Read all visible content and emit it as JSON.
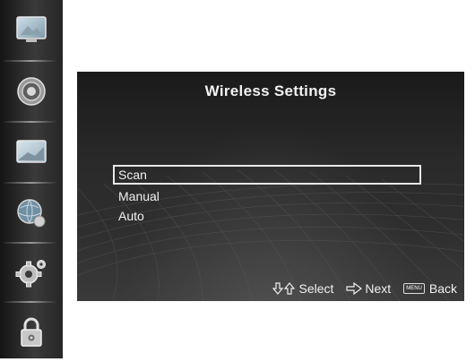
{
  "sidebar": {
    "items": [
      {
        "icon": "picture-icon"
      },
      {
        "icon": "sound-icon"
      },
      {
        "icon": "screen-icon"
      },
      {
        "icon": "network-icon"
      },
      {
        "icon": "settings-gear-icon"
      },
      {
        "icon": "lock-icon"
      }
    ]
  },
  "panel": {
    "title": "Wireless Settings",
    "menu": [
      {
        "label": "Scan",
        "selected": true
      },
      {
        "label": "Manual",
        "selected": false
      },
      {
        "label": "Auto",
        "selected": false
      }
    ]
  },
  "footer": {
    "select_label": "Select",
    "next_label": "Next",
    "menu_key_label": "MENU",
    "back_label": "Back"
  },
  "colors": {
    "panel_background": "#2a2a2a",
    "text": "#f0f0f0",
    "highlight_border": "#e8e8e8"
  }
}
